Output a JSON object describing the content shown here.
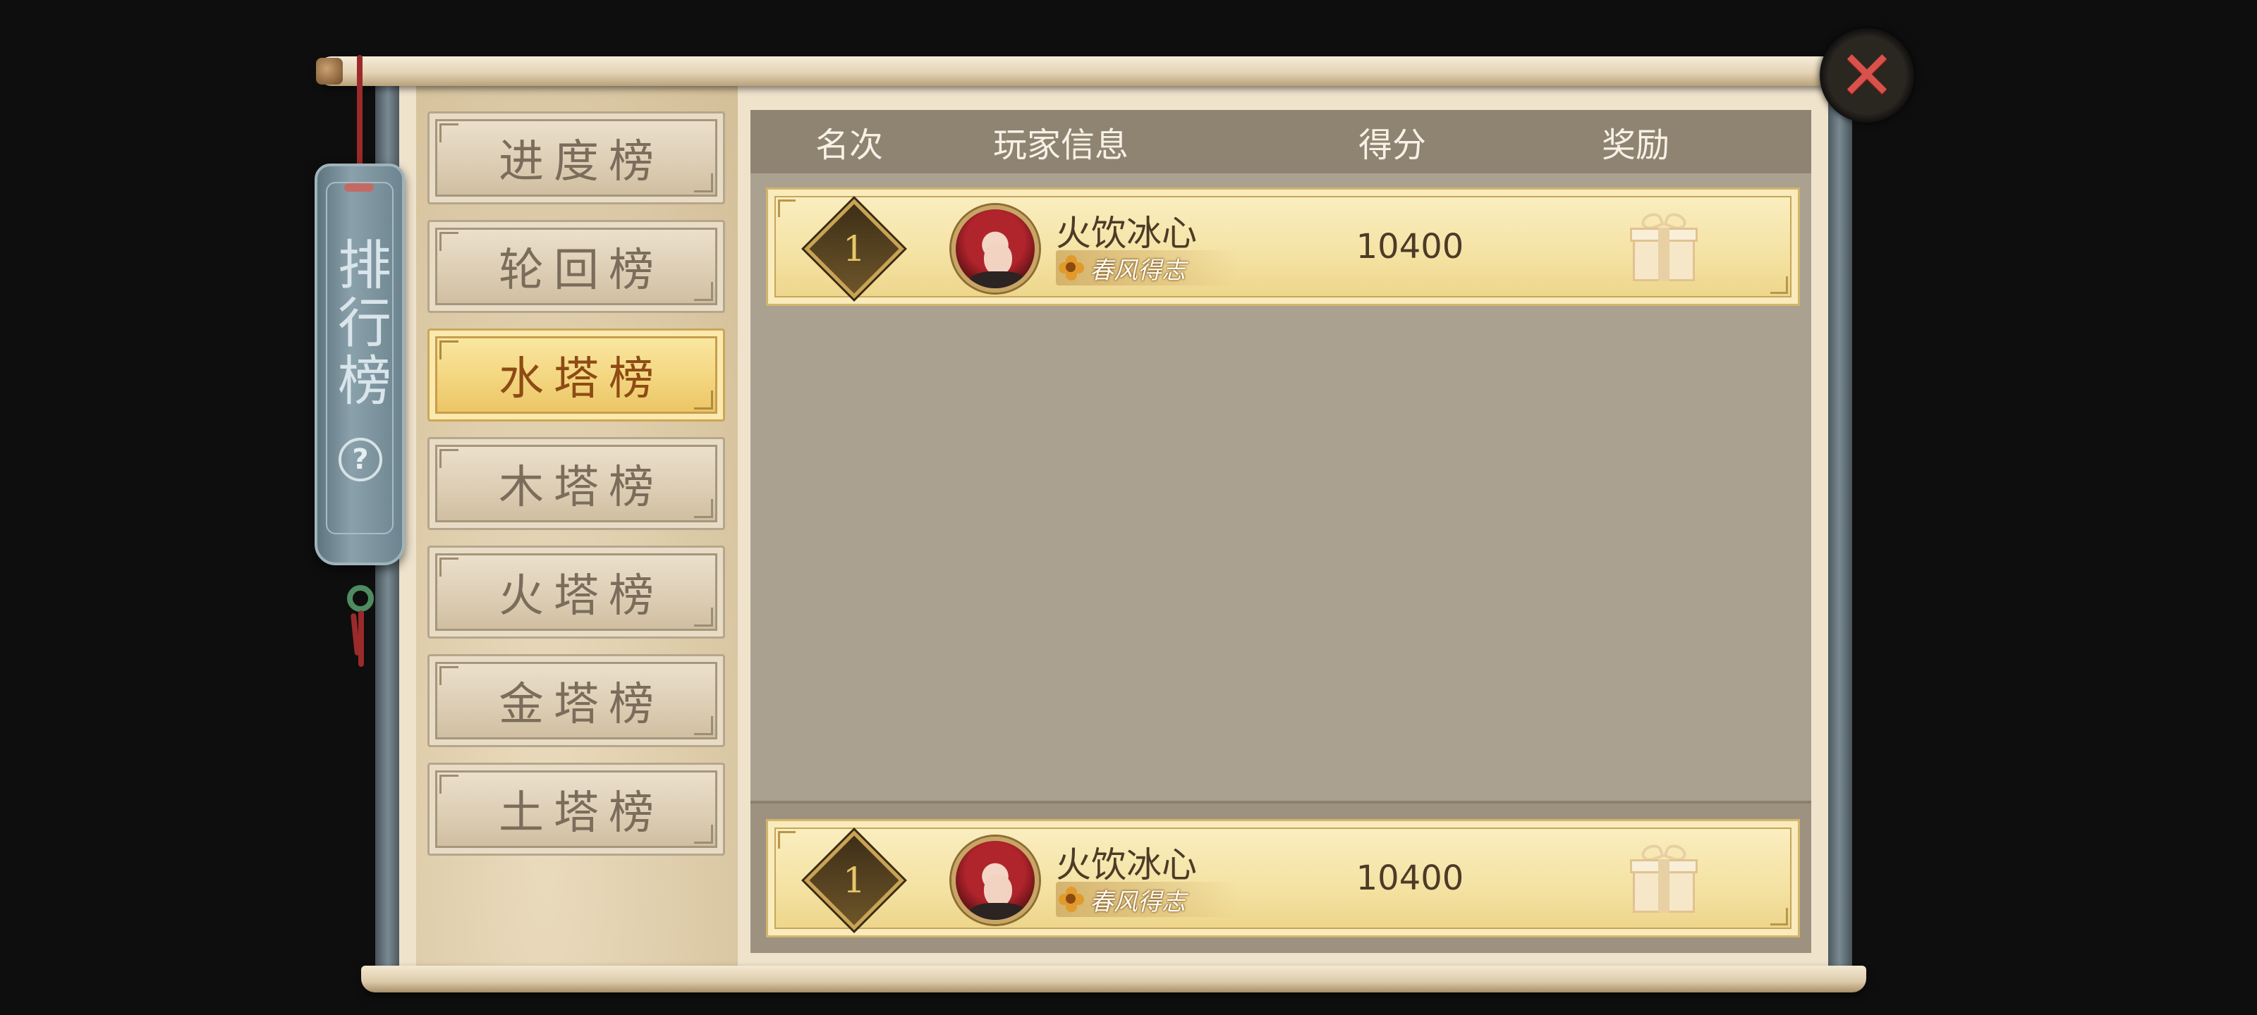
{
  "title": "排行榜",
  "help_icon": "?",
  "close_icon": "✕",
  "tabs": [
    {
      "label": "进度榜",
      "active": false
    },
    {
      "label": "轮回榜",
      "active": false
    },
    {
      "label": "水塔榜",
      "active": true
    },
    {
      "label": "木塔榜",
      "active": false
    },
    {
      "label": "火塔榜",
      "active": false
    },
    {
      "label": "金塔榜",
      "active": false
    },
    {
      "label": "土塔榜",
      "active": false
    }
  ],
  "columns": [
    "名次",
    "玩家信息",
    "得分",
    "奖励"
  ],
  "rows": [
    {
      "rank": "1",
      "name": "火饮冰心",
      "tag": "春风得志",
      "score": "10400",
      "reward_icon": "gift-icon"
    }
  ],
  "my_rank": {
    "rank": "1",
    "name": "火饮冰心",
    "tag": "春风得志",
    "score": "10400",
    "reward_icon": "gift-icon"
  },
  "colors": {
    "active_tab": "#f3d57e",
    "row_bg": "#f4e2a2",
    "header_bg": "#8f8472",
    "close_accent": "#d9514b"
  }
}
